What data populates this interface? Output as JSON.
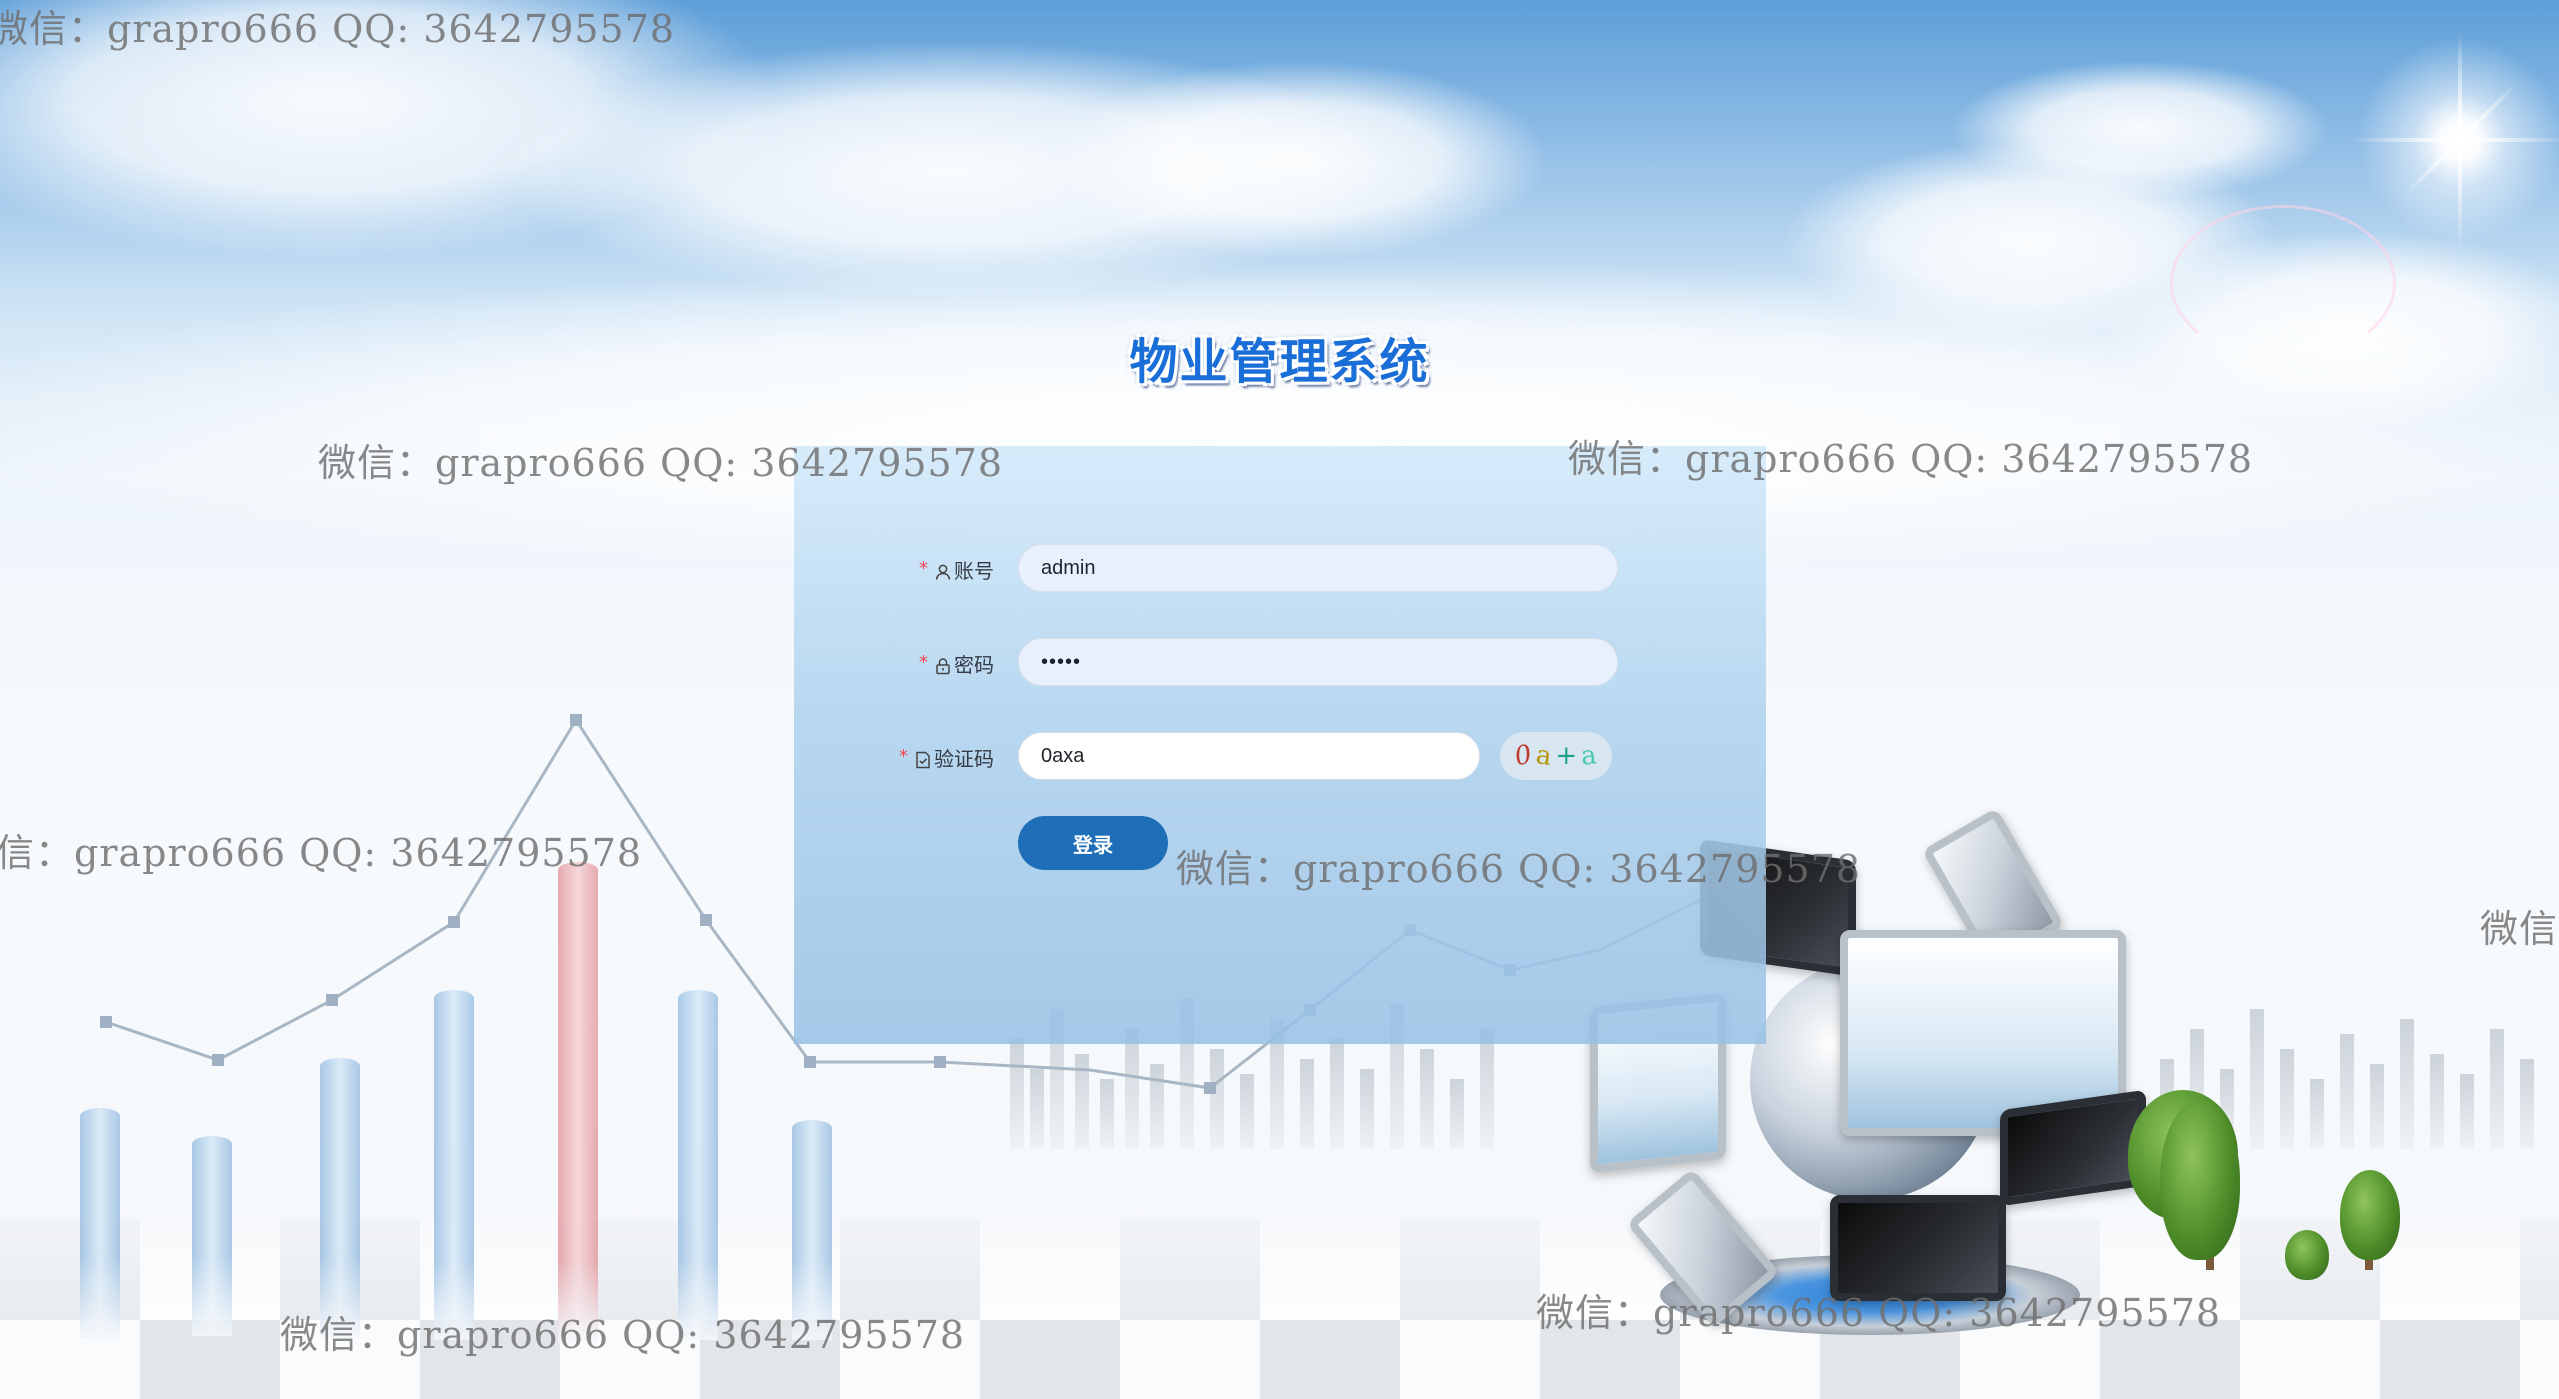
{
  "page": {
    "title": "物业管理系统"
  },
  "login_form": {
    "account": {
      "required_mark": "*",
      "label": "账号",
      "value": "admin"
    },
    "password": {
      "required_mark": "*",
      "label": "密码",
      "value": "•••••"
    },
    "captcha": {
      "required_mark": "*",
      "label": "验证码",
      "value": "0axa",
      "image_chars": [
        {
          "char": "0",
          "color": "#c0392b"
        },
        {
          "char": "a",
          "color": "#b7950b"
        },
        {
          "char": "+",
          "color": "#16a085"
        },
        {
          "char": "a",
          "color": "#48c9b0"
        }
      ]
    },
    "submit_label": "登录"
  },
  "watermarks": [
    "微信：grapro666 QQ: 3642795578",
    "微信：grapro666 QQ: 3642795578",
    "微信：grapro666 QQ: 3642795578",
    "信：grapro666 QQ: 3642795578",
    "微信：grapro666 QQ: 3642795578",
    "微信",
    "微信：grapro666 QQ: 3642795578",
    "微信：grapro666 QQ: 3642795578"
  ],
  "colors": {
    "title": "#1a6ed8",
    "button": "#1f6fb8",
    "required": "#f0484e"
  }
}
